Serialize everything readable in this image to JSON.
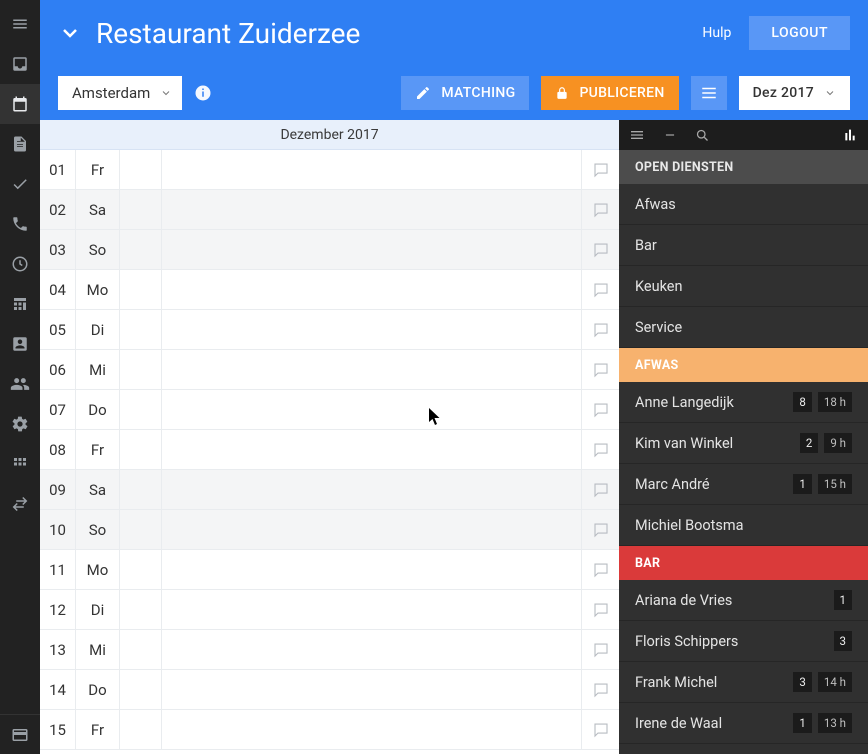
{
  "header": {
    "title": "Restaurant Zuiderzee",
    "help": "Hulp",
    "logout": "LOGOUT"
  },
  "toolbar": {
    "location": "Amsterdam",
    "matching": "MATCHING",
    "publiceren": "PUBLICEREN",
    "date": "Dez 2017"
  },
  "calendar": {
    "month_title": "Dezember 2017",
    "days": [
      {
        "num": "01",
        "name": "Fr",
        "weekend": false
      },
      {
        "num": "02",
        "name": "Sa",
        "weekend": true
      },
      {
        "num": "03",
        "name": "So",
        "weekend": true
      },
      {
        "num": "04",
        "name": "Mo",
        "weekend": false
      },
      {
        "num": "05",
        "name": "Di",
        "weekend": false
      },
      {
        "num": "06",
        "name": "Mi",
        "weekend": false
      },
      {
        "num": "07",
        "name": "Do",
        "weekend": false
      },
      {
        "num": "08",
        "name": "Fr",
        "weekend": false
      },
      {
        "num": "09",
        "name": "Sa",
        "weekend": true
      },
      {
        "num": "10",
        "name": "So",
        "weekend": true
      },
      {
        "num": "11",
        "name": "Mo",
        "weekend": false
      },
      {
        "num": "12",
        "name": "Di",
        "weekend": false
      },
      {
        "num": "13",
        "name": "Mi",
        "weekend": false
      },
      {
        "num": "14",
        "name": "Do",
        "weekend": false
      },
      {
        "num": "15",
        "name": "Fr",
        "weekend": false
      }
    ]
  },
  "sidepanel": {
    "sections": {
      "open_diensten": "OPEN DIENSTEN",
      "afwas": "AFWAS",
      "bar": "BAR"
    },
    "open_items": [
      {
        "label": "Afwas"
      },
      {
        "label": "Bar"
      },
      {
        "label": "Keuken"
      },
      {
        "label": "Service"
      }
    ],
    "afwas_items": [
      {
        "label": "Anne Langedijk",
        "count": "8",
        "hours": "18 h"
      },
      {
        "label": "Kim van Winkel",
        "count": "2",
        "hours": "9 h"
      },
      {
        "label": "Marc André",
        "count": "1",
        "hours": "15 h"
      },
      {
        "label": "Michiel Bootsma"
      }
    ],
    "bar_items": [
      {
        "label": "Ariana de Vries",
        "count": "1"
      },
      {
        "label": "Floris Schippers",
        "count": "3"
      },
      {
        "label": "Frank Michel",
        "count": "3",
        "hours": "14 h"
      },
      {
        "label": "Irene de Waal",
        "count": "1",
        "hours": "13 h"
      }
    ]
  }
}
